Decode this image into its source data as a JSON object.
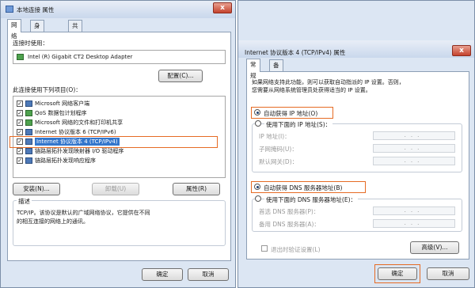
{
  "left": {
    "title": "本地连接 属性",
    "close": "x",
    "tabs": [
      "网络",
      "身份验证",
      "共享"
    ],
    "connect_using_label": "连接时使用：",
    "adapter_name": "Intel (R) Gigabit CT2 Desktop Adapter",
    "configure_button": "配置(C)...",
    "items_label": "此连接使用下列项目(O)：",
    "items": [
      {
        "label": "Microsoft 网络客户端",
        "checked": true
      },
      {
        "label": "QoS 数据包计划程序",
        "checked": true
      },
      {
        "label": "Microsoft 网络的文件和打印机共享",
        "checked": true
      },
      {
        "label": "Internet 协议版本 6 (TCP/IPv6)",
        "checked": true
      },
      {
        "label": "Internet 协议版本 4 (TCP/IPv4)",
        "checked": true,
        "selected": true
      },
      {
        "label": "链路层拓扑发现映射器 I/O 驱动程序",
        "checked": true
      },
      {
        "label": "链路层拓扑发现响应程序",
        "checked": true
      }
    ],
    "install_button": "安装(N)...",
    "uninstall_button": "卸载(U)",
    "properties_button": "属性(R)",
    "description_label": "描述",
    "description_text_1": "TCP/IP。该协议是默认的广域网络协议，它提供在不同",
    "description_text_2": "的相互连接的网络上的通讯。",
    "ok_button": "确定",
    "cancel_button": "取消"
  },
  "right": {
    "title": "Internet 协议版本 4 (TCP/IPv4) 属性",
    "close": "x",
    "tabs": [
      "常规",
      "备用配置"
    ],
    "intro_1": "如果网络支持此功能，则可以获取自动指派的 IP 设置。否则，",
    "intro_2": "您需要从网络系统管理员处获得适当的 IP 设置。",
    "auto_ip": "自动获得 IP 地址(O)",
    "manual_ip": "使用下面的 IP 地址(S)：",
    "ip_address": "IP 地址(I)：",
    "subnet_mask": "子网掩码(U)：",
    "gateway": "默认网关(D)：",
    "ip_placeholder": "...",
    "auto_dns": "自动获得 DNS 服务器地址(B)",
    "manual_dns": "使用下面的 DNS 服务器地址(E)：",
    "preferred_dns": "首选 DNS 服务器(P)：",
    "alternate_dns": "备用 DNS 服务器(A)：",
    "validate_on_exit": "退出时验证设置(L)",
    "advanced_button": "高级(V)...",
    "ok_button": "确定",
    "cancel_button": "取消"
  },
  "colors": {
    "highlight": "#e66b24",
    "selection": "#3376cc",
    "dialog_bg": "#dce6f3"
  }
}
